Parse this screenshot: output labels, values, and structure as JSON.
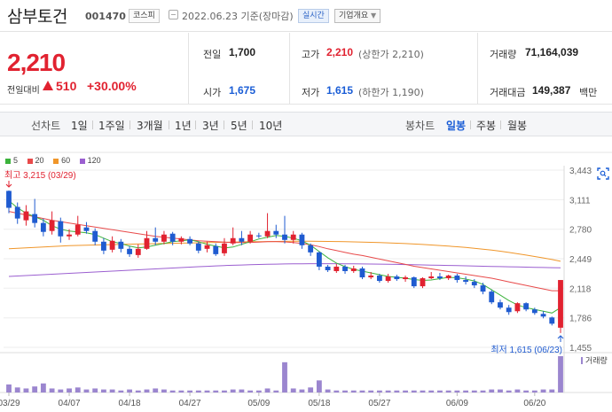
{
  "header": {
    "stock_name": "삼부토건",
    "stock_code": "001470",
    "market": "코스피",
    "date": "2022.06.23 기준(장마감)",
    "realtime_label": "실시간",
    "overview_label": "기업개요"
  },
  "price": {
    "current": "2,210",
    "diff_label": "전일대비",
    "diff_value": "510",
    "diff_rate": "+30.00%"
  },
  "stats": {
    "prev_label": "전일",
    "prev_value": "1,700",
    "high_label": "고가",
    "high_value": "2,210",
    "high_sub": "(상한가 2,210)",
    "volume_label": "거래량",
    "volume_value": "71,164,039",
    "open_label": "시가",
    "open_value": "1,675",
    "low_label": "저가",
    "low_value": "1,615",
    "low_sub": "(하한가 1,190)",
    "amount_label": "거래대금",
    "amount_value": "149,387",
    "amount_unit": "백만"
  },
  "periods": {
    "line_label": "선차트",
    "items": [
      "1일",
      "1주일",
      "3개월",
      "1년",
      "3년",
      "5년",
      "10년"
    ],
    "candle_label": "봉차트",
    "candle_items": [
      "일봉",
      "주봉",
      "월봉"
    ],
    "candle_active": "일봉"
  },
  "chart_data": {
    "type": "candlestick",
    "ma_legend": [
      {
        "name": "5",
        "color": "#3cb33c"
      },
      {
        "name": "20",
        "color": "#e84a4a"
      },
      {
        "name": "60",
        "color": "#f0962a"
      },
      {
        "name": "120",
        "color": "#9b5fd0"
      }
    ],
    "y_ticks": [
      "3,443",
      "3,111",
      "2,780",
      "2,449",
      "2,118",
      "1,786",
      "1,455"
    ],
    "y_min": 1455,
    "y_max": 3443,
    "x_ticks": [
      "03/29",
      "04/07",
      "04/18",
      "04/27",
      "05/09",
      "05/18",
      "05/27",
      "06/09",
      "06/20"
    ],
    "high_annotation": "최고 3,215 (03/29)",
    "low_annotation": "최저 1,615 (06/23)",
    "volume_label": "거래량",
    "candles": [
      {
        "o": 3210,
        "c": 3020,
        "h": 3215,
        "l": 2960
      },
      {
        "o": 3030,
        "c": 2900,
        "h": 3080,
        "l": 2840
      },
      {
        "o": 2880,
        "c": 2980,
        "h": 3050,
        "l": 2820
      },
      {
        "o": 2950,
        "c": 2850,
        "h": 3120,
        "l": 2800
      },
      {
        "o": 2850,
        "c": 2750,
        "h": 2900,
        "l": 2700
      },
      {
        "o": 2760,
        "c": 2880,
        "h": 2980,
        "l": 2720
      },
      {
        "o": 2870,
        "c": 2700,
        "h": 2910,
        "l": 2630
      },
      {
        "o": 2700,
        "c": 2720,
        "h": 2780,
        "l": 2660
      },
      {
        "o": 2720,
        "c": 2830,
        "h": 2930,
        "l": 2700
      },
      {
        "o": 2800,
        "c": 2760,
        "h": 2860,
        "l": 2730
      },
      {
        "o": 2760,
        "c": 2640,
        "h": 2790,
        "l": 2600
      },
      {
        "o": 2640,
        "c": 2540,
        "h": 2680,
        "l": 2500
      },
      {
        "o": 2550,
        "c": 2650,
        "h": 2700,
        "l": 2520
      },
      {
        "o": 2640,
        "c": 2560,
        "h": 2670,
        "l": 2520
      },
      {
        "o": 2560,
        "c": 2500,
        "h": 2590,
        "l": 2470
      },
      {
        "o": 2490,
        "c": 2560,
        "h": 2610,
        "l": 2460
      },
      {
        "o": 2560,
        "c": 2680,
        "h": 2760,
        "l": 2550
      },
      {
        "o": 2680,
        "c": 2640,
        "h": 2800,
        "l": 2600
      },
      {
        "o": 2640,
        "c": 2720,
        "h": 2760,
        "l": 2610
      },
      {
        "o": 2730,
        "c": 2640,
        "h": 2750,
        "l": 2600
      },
      {
        "o": 2640,
        "c": 2680,
        "h": 2700,
        "l": 2610
      },
      {
        "o": 2670,
        "c": 2620,
        "h": 2700,
        "l": 2600
      },
      {
        "o": 2620,
        "c": 2540,
        "h": 2640,
        "l": 2510
      },
      {
        "o": 2560,
        "c": 2600,
        "h": 2640,
        "l": 2520
      },
      {
        "o": 2590,
        "c": 2500,
        "h": 2620,
        "l": 2480
      },
      {
        "o": 2510,
        "c": 2620,
        "h": 2680,
        "l": 2480
      },
      {
        "o": 2620,
        "c": 2680,
        "h": 2800,
        "l": 2600
      },
      {
        "o": 2680,
        "c": 2640,
        "h": 2760,
        "l": 2600
      },
      {
        "o": 2640,
        "c": 2720,
        "h": 2760,
        "l": 2620
      },
      {
        "o": 2710,
        "c": 2700,
        "h": 2740,
        "l": 2680
      },
      {
        "o": 2700,
        "c": 2760,
        "h": 2960,
        "l": 2680
      },
      {
        "o": 2760,
        "c": 2720,
        "h": 2830,
        "l": 2680
      },
      {
        "o": 2720,
        "c": 2660,
        "h": 2930,
        "l": 2620
      },
      {
        "o": 2660,
        "c": 2720,
        "h": 2760,
        "l": 2620
      },
      {
        "o": 2720,
        "c": 2600,
        "h": 2740,
        "l": 2560
      },
      {
        "o": 2600,
        "c": 2520,
        "h": 2620,
        "l": 2480
      },
      {
        "o": 2520,
        "c": 2360,
        "h": 2530,
        "l": 2320
      },
      {
        "o": 2360,
        "c": 2320,
        "h": 2380,
        "l": 2300
      },
      {
        "o": 2310,
        "c": 2360,
        "h": 2390,
        "l": 2290
      },
      {
        "o": 2360,
        "c": 2310,
        "h": 2380,
        "l": 2280
      },
      {
        "o": 2310,
        "c": 2340,
        "h": 2370,
        "l": 2290
      },
      {
        "o": 2340,
        "c": 2240,
        "h": 2360,
        "l": 2220
      },
      {
        "o": 2240,
        "c": 2260,
        "h": 2300,
        "l": 2220
      },
      {
        "o": 2260,
        "c": 2200,
        "h": 2280,
        "l": 2180
      },
      {
        "o": 2200,
        "c": 2250,
        "h": 2280,
        "l": 2180
      },
      {
        "o": 2250,
        "c": 2220,
        "h": 2270,
        "l": 2200
      },
      {
        "o": 2220,
        "c": 2240,
        "h": 2260,
        "l": 2190
      },
      {
        "o": 2240,
        "c": 2140,
        "h": 2250,
        "l": 2120
      },
      {
        "o": 2140,
        "c": 2230,
        "h": 2240,
        "l": 2120
      },
      {
        "o": 2230,
        "c": 2250,
        "h": 2300,
        "l": 2220
      },
      {
        "o": 2250,
        "c": 2230,
        "h": 2290,
        "l": 2210
      },
      {
        "o": 2230,
        "c": 2260,
        "h": 2270,
        "l": 2210
      },
      {
        "o": 2260,
        "c": 2210,
        "h": 2280,
        "l": 2180
      },
      {
        "o": 2210,
        "c": 2190,
        "h": 2250,
        "l": 2160
      },
      {
        "o": 2190,
        "c": 2150,
        "h": 2220,
        "l": 2120
      },
      {
        "o": 2150,
        "c": 2080,
        "h": 2180,
        "l": 2050
      },
      {
        "o": 2080,
        "c": 1960,
        "h": 2100,
        "l": 1940
      },
      {
        "o": 1960,
        "c": 1900,
        "h": 1990,
        "l": 1880
      },
      {
        "o": 1900,
        "c": 1850,
        "h": 1930,
        "l": 1820
      },
      {
        "o": 1860,
        "c": 1950,
        "h": 1960,
        "l": 1840
      },
      {
        "o": 1950,
        "c": 1880,
        "h": 1960,
        "l": 1860
      },
      {
        "o": 1880,
        "c": 1840,
        "h": 1900,
        "l": 1820
      },
      {
        "o": 1830,
        "c": 1800,
        "h": 1860,
        "l": 1780
      },
      {
        "o": 1790,
        "c": 1720,
        "h": 1800,
        "l": 1700
      },
      {
        "o": 1675,
        "c": 2210,
        "h": 2210,
        "l": 1615
      }
    ],
    "ma5": [
      3100,
      3020,
      2960,
      2920,
      2880,
      2820,
      2780,
      2760,
      2750,
      2740,
      2720,
      2680,
      2640,
      2620,
      2590,
      2570,
      2580,
      2600,
      2620,
      2640,
      2650,
      2660,
      2640,
      2610,
      2590,
      2570,
      2580,
      2610,
      2640,
      2670,
      2690,
      2710,
      2700,
      2680,
      2650,
      2600,
      2530,
      2460,
      2400,
      2360,
      2330,
      2310,
      2290,
      2270,
      2250,
      2240,
      2230,
      2215,
      2205,
      2210,
      2225,
      2240,
      2235,
      2220,
      2200,
      2160,
      2100,
      2040,
      1980,
      1930,
      1900,
      1880,
      1860,
      1840,
      1900
    ],
    "ma20": [
      2980,
      2960,
      2940,
      2920,
      2900,
      2880,
      2865,
      2850,
      2835,
      2820,
      2805,
      2790,
      2775,
      2760,
      2745,
      2730,
      2715,
      2700,
      2690,
      2680,
      2670,
      2660,
      2650,
      2645,
      2640,
      2635,
      2630,
      2630,
      2632,
      2635,
      2640,
      2640,
      2638,
      2630,
      2620,
      2605,
      2585,
      2560,
      2540,
      2520,
      2500,
      2485,
      2465,
      2445,
      2425,
      2405,
      2385,
      2365,
      2350,
      2335,
      2320,
      2305,
      2290,
      2275,
      2260,
      2245,
      2230,
      2210,
      2190,
      2170,
      2150,
      2130,
      2110,
      2090,
      2090
    ],
    "ma60": [
      2560,
      2565,
      2570,
      2575,
      2580,
      2585,
      2590,
      2595,
      2598,
      2600,
      2603,
      2605,
      2607,
      2610,
      2612,
      2614,
      2616,
      2618,
      2620,
      2622,
      2624,
      2626,
      2628,
      2630,
      2632,
      2634,
      2636,
      2638,
      2640,
      2641,
      2642,
      2643,
      2644,
      2645,
      2645,
      2645,
      2644,
      2643,
      2642,
      2640,
      2638,
      2636,
      2633,
      2630,
      2627,
      2623,
      2619,
      2614,
      2609,
      2603,
      2597,
      2590,
      2583,
      2575,
      2566,
      2556,
      2545,
      2533,
      2520,
      2505,
      2490,
      2474,
      2458,
      2440,
      2420
    ],
    "ma120": [
      2250,
      2255,
      2260,
      2265,
      2270,
      2275,
      2280,
      2285,
      2290,
      2295,
      2300,
      2305,
      2310,
      2315,
      2320,
      2325,
      2330,
      2335,
      2340,
      2345,
      2350,
      2355,
      2360,
      2364,
      2368,
      2372,
      2375,
      2378,
      2381,
      2384,
      2386,
      2388,
      2390,
      2391,
      2392,
      2393,
      2393,
      2393,
      2393,
      2392,
      2391,
      2390,
      2389,
      2388,
      2386,
      2385,
      2383,
      2381,
      2379,
      2377,
      2375,
      2373,
      2371,
      2369,
      2367,
      2365,
      2363,
      2361,
      2359,
      2357,
      2355,
      2353,
      2351,
      2349,
      2347
    ],
    "volume": [
      8,
      5,
      4,
      6,
      9,
      4,
      3,
      4,
      5,
      3,
      4,
      3,
      3,
      2,
      3,
      2,
      3,
      4,
      3,
      2,
      2,
      2,
      2,
      2,
      2,
      2,
      3,
      3,
      2,
      2,
      4,
      2,
      30,
      4,
      3,
      5,
      12,
      3,
      2,
      2,
      2,
      2,
      2,
      2,
      2,
      2,
      2,
      2,
      2,
      2,
      2,
      2,
      2,
      2,
      2,
      2,
      3,
      3,
      2,
      3,
      2,
      2,
      3,
      3,
      36
    ]
  }
}
